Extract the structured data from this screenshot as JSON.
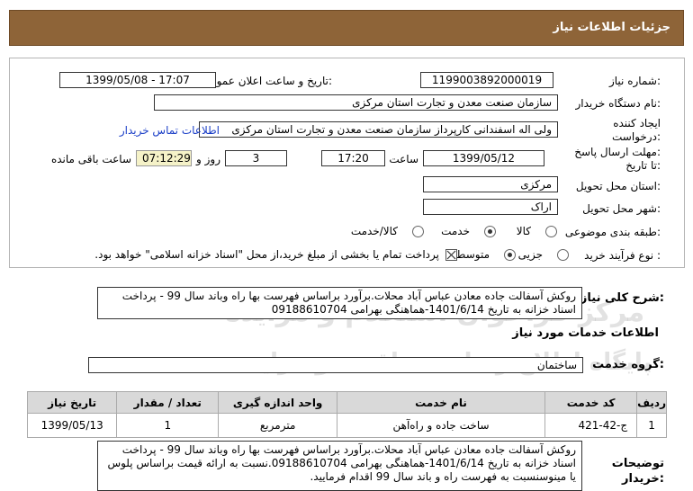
{
  "header": {
    "title": "جزئیات اطلاعات نیاز"
  },
  "fields": {
    "need_number_label": "شماره نیاز:",
    "need_number": "1199003892000019",
    "announce_label": "تاریخ و ساعت اعلان عمومی:",
    "announce_value": "1399/05/08 - 17:07",
    "buyer_org_label": "نام دستگاه خریدار:",
    "buyer_org": "سازمان صنعت معدن و تجارت استان مرکزی",
    "creator_label_1": "ایجاد کننده",
    "creator_label_2": "درخواست:",
    "creator": "ولی اله اسفندانی کارپرداز سازمان صنعت معدن و تجارت استان مرکزی",
    "buyer_contact_link": "اطلاعات تماس خریدار",
    "deadline_label_1": "مهلت ارسال پاسخ:",
    "deadline_label_2": "تا تاریخ:",
    "deadline_date": "1399/05/12",
    "time_label": "ساعت",
    "deadline_time": "17:20",
    "days_count": "3",
    "days_label": "روز و",
    "remaining_time": "07:12:29",
    "remaining_label": "ساعت باقی مانده",
    "province_label": "استان محل تحویل:",
    "province": "مرکزی",
    "city_label": "شهر محل تحویل:",
    "city": "اراک",
    "category_label": "طبقه بندی موضوعی:",
    "category_options": [
      "کالا",
      "خدمت",
      "کالا/خدمت"
    ],
    "category_selected": "خدمت",
    "process_label": "نوع فرآیند خرید :",
    "process_options": [
      "جزیی",
      "متوسط"
    ],
    "process_selected": "متوسط",
    "payment_note": "پرداخت تمام یا بخشی از مبلغ خرید،از محل \"اسناد خزانه اسلامی\" خواهد بود.",
    "payment_checked": true
  },
  "summary": {
    "label": "شرح کلی نیاز:",
    "text": "روکش آسفالت جاده معادن عباس آباد محلات.برآورد براساس فهرست بها راه وباند سال 99 - پرداخت اسناد خزانه به تاریخ 1401/6/14-هماهنگی بهرامی 09188610704"
  },
  "services_info": {
    "title": "اطلاعات خدمات مورد نیاز"
  },
  "service_group": {
    "label": "گروه خدمت:",
    "value": "ساختمان"
  },
  "table": {
    "headers": [
      "ردیف",
      "کد خدمت",
      "نام خدمت",
      "واحد اندازه گیری",
      "تعداد / مقدار",
      "تاریخ نیاز"
    ],
    "rows": [
      [
        "1",
        "ج-42-421",
        "ساخت جاده و راه‌آهن",
        "مترمربع",
        "1",
        "1399/05/13"
      ]
    ]
  },
  "buyer_notes": {
    "label_1": "توضیحات",
    "label_2": "خریدار:",
    "text": "روکش آسفالت جاده معادن عباس آباد محلات.برآورد براساس فهرست بها راه وباند سال 99 - پرداخت اسناد خزانه به تاریخ 1401/6/14-هماهنگی بهرامی 09188610704.نسبت به ارائه قیمت براساس پلوس یا مینوسنسبت به فهرست راه و باند سال 99 اقدام فرمایید."
  },
  "colors": {
    "header_bg": "#8e6438",
    "link": "#1a3ec7",
    "remaining_bg": "#f5f2c8",
    "table_header_bg": "#d9d9d9"
  }
}
